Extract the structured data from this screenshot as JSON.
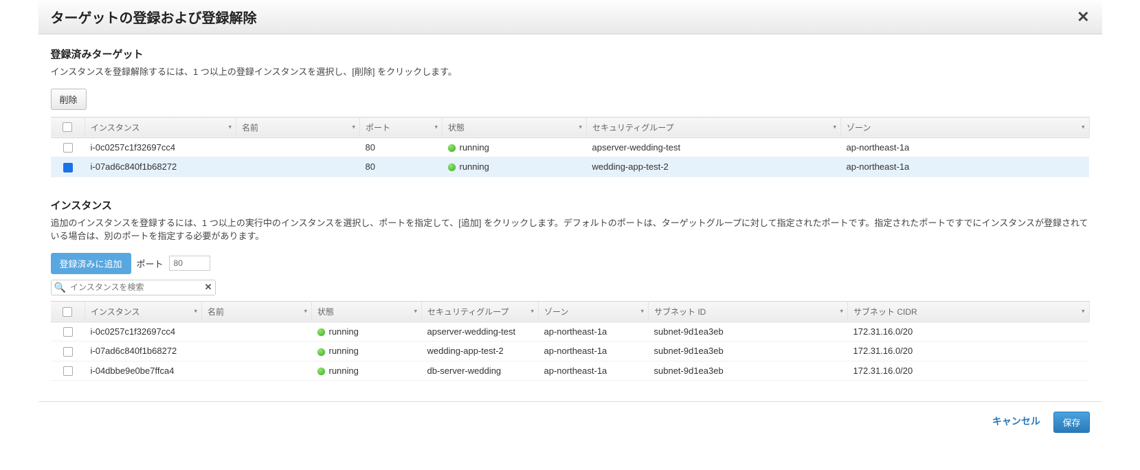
{
  "dialog": {
    "title": "ターゲットの登録および登録解除",
    "close": "✕"
  },
  "registered": {
    "title": "登録済みターゲット",
    "desc": "インスタンスを登録解除するには、1 つ以上の登録インスタンスを選択し、[削除] をクリックします。",
    "remove_button": "削除",
    "columns": {
      "instance": "インスタンス",
      "name": "名前",
      "port": "ポート",
      "status": "状態",
      "sg": "セキュリティグループ",
      "zone": "ゾーン"
    },
    "rows": [
      {
        "selected": false,
        "instance": "i-0c0257c1f32697cc4",
        "name": "",
        "port": "80",
        "status": "running",
        "sg": "apserver-wedding-test",
        "zone": "ap-northeast-1a"
      },
      {
        "selected": true,
        "instance": "i-07ad6c840f1b68272",
        "name": "",
        "port": "80",
        "status": "running",
        "sg": "wedding-app-test-2",
        "zone": "ap-northeast-1a"
      }
    ]
  },
  "available": {
    "title": "インスタンス",
    "desc": "追加のインスタンスを登録するには、1 つ以上の実行中のインスタンスを選択し、ポートを指定して、[追加] をクリックします。デフォルトのポートは、ターゲットグループに対して指定されたポートです。指定されたポートですでにインスタンスが登録されている場合は、別のポートを指定する必要があります。",
    "add_button": "登録済みに追加",
    "port_label": "ポート",
    "port_value": "80",
    "search_placeholder": "インスタンスを検索",
    "columns": {
      "instance": "インスタンス",
      "name": "名前",
      "status": "状態",
      "sg": "セキュリティグループ",
      "zone": "ゾーン",
      "subnet_id": "サブネット ID",
      "subnet_cidr": "サブネット CIDR"
    },
    "rows": [
      {
        "instance": "i-0c0257c1f32697cc4",
        "name": "",
        "status": "running",
        "sg": "apserver-wedding-test",
        "zone": "ap-northeast-1a",
        "subnet_id": "subnet-9d1ea3eb",
        "subnet_cidr": "172.31.16.0/20"
      },
      {
        "instance": "i-07ad6c840f1b68272",
        "name": "",
        "status": "running",
        "sg": "wedding-app-test-2",
        "zone": "ap-northeast-1a",
        "subnet_id": "subnet-9d1ea3eb",
        "subnet_cidr": "172.31.16.0/20"
      },
      {
        "instance": "i-04dbbe9e0be7ffca4",
        "name": "",
        "status": "running",
        "sg": "db-server-wedding",
        "zone": "ap-northeast-1a",
        "subnet_id": "subnet-9d1ea3eb",
        "subnet_cidr": "172.31.16.0/20"
      }
    ]
  },
  "footer": {
    "cancel": "キャンセル",
    "save": "保存"
  }
}
